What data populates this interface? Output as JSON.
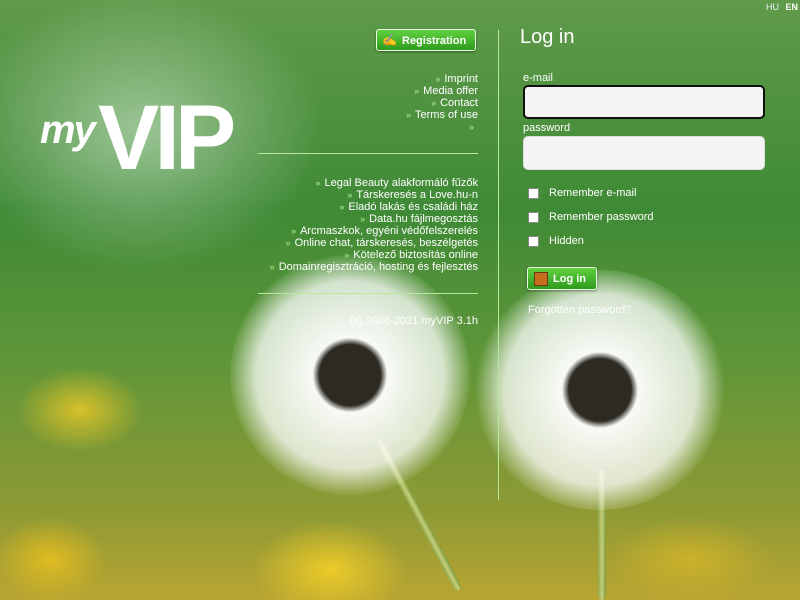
{
  "language": {
    "options": [
      "HU",
      "EN"
    ],
    "active": "EN"
  },
  "logo": {
    "part1": "my",
    "part2": "VIP"
  },
  "registration_button": "Registration",
  "links": [
    "Imprint",
    "Media offer",
    "Contact",
    "Terms of use",
    ""
  ],
  "ads": [
    "Legal Beauty alakformáló fűzők",
    "Társkeresés a Love.hu-n",
    "Eladó lakás és családi ház",
    "Data.hu fájlmegosztás",
    "Arcmaszkok, egyéni védőfelszerelés",
    "Online chat, társkeresés, beszélgetés",
    "Kötelező biztosítás online",
    "Domainregisztráció, hosting és fejlesztés"
  ],
  "copyright": "(c) 2006-2021 myVIP 3.1h",
  "login": {
    "title": "Log in",
    "email_label": "e-mail",
    "email_value": "",
    "password_label": "password",
    "password_value": "",
    "checkboxes": [
      "Remember e-mail",
      "Remember password",
      "Hidden"
    ],
    "button": "Log in",
    "forgot": "Forgotten password?"
  },
  "colors": {
    "accent": "#3aa82a",
    "divider": "#b8e89a"
  },
  "icons": {
    "registration": "pencil-hand-icon",
    "login": "door-enter-icon",
    "bullet": "double-chevron-icon"
  }
}
